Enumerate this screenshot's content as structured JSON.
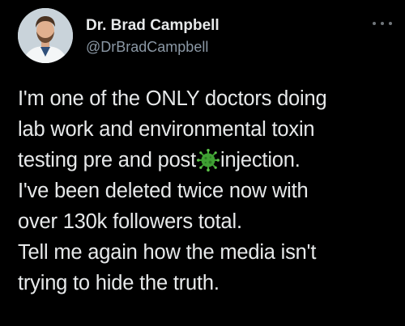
{
  "author": {
    "display_name": "Dr. Brad Campbell",
    "handle": "@DrBradCampbell"
  },
  "tweet": {
    "line1": "I'm one of the ONLY doctors doing",
    "line2": "lab work and environmental toxin",
    "line3a": "testing pre and post",
    "line3_icon": "virus-emoji-icon",
    "line3b": "injection.",
    "line4": "I've been deleted twice now with",
    "line5": "over 130k followers total.",
    "line6": "Tell me again how the media isn't",
    "line7": "trying to hide the truth."
  },
  "colors": {
    "background": "#000000",
    "text": "#e7e9ea",
    "secondary": "#8b98a5",
    "virus": "#3fa033"
  }
}
